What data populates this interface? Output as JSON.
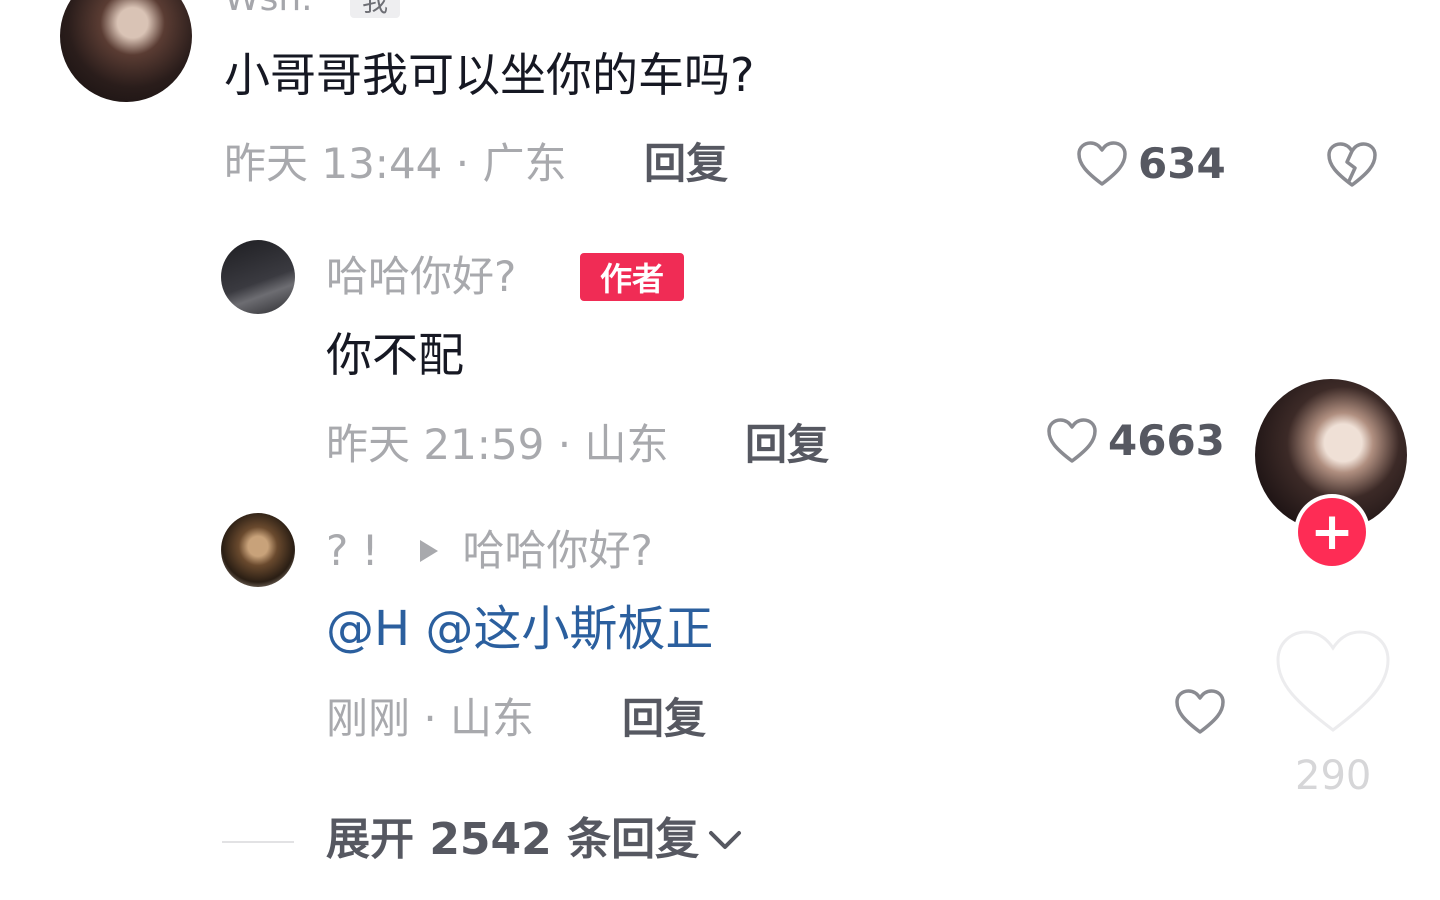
{
  "main_comment": {
    "username": "Wsh.",
    "me_badge": "我",
    "text": "小哥哥我可以坐你的车吗?",
    "meta": "昨天 13:44 · 广东",
    "reply_label": "回复",
    "likes": "634"
  },
  "author_reply": {
    "nickname": "哈哈你好?",
    "author_badge": "作者",
    "text": "你不配",
    "meta": "昨天 21:59 · 山东",
    "reply_label": "回复",
    "likes": "4663"
  },
  "nested_reply": {
    "nickname": "? !",
    "reply_to": "哈哈你好?",
    "mention_1": "@H",
    "mention_2": "@这小斯板正",
    "meta": "刚刚 · 山东",
    "reply_label": "回复"
  },
  "sidebar": {
    "like_count": "290",
    "follow_icon": "plus-icon"
  },
  "expand": {
    "label": "展开 2542 条回复"
  },
  "colors": {
    "accent": "#fe2c55",
    "mention": "#2b5f9e",
    "meta": "#a8a9ad"
  }
}
